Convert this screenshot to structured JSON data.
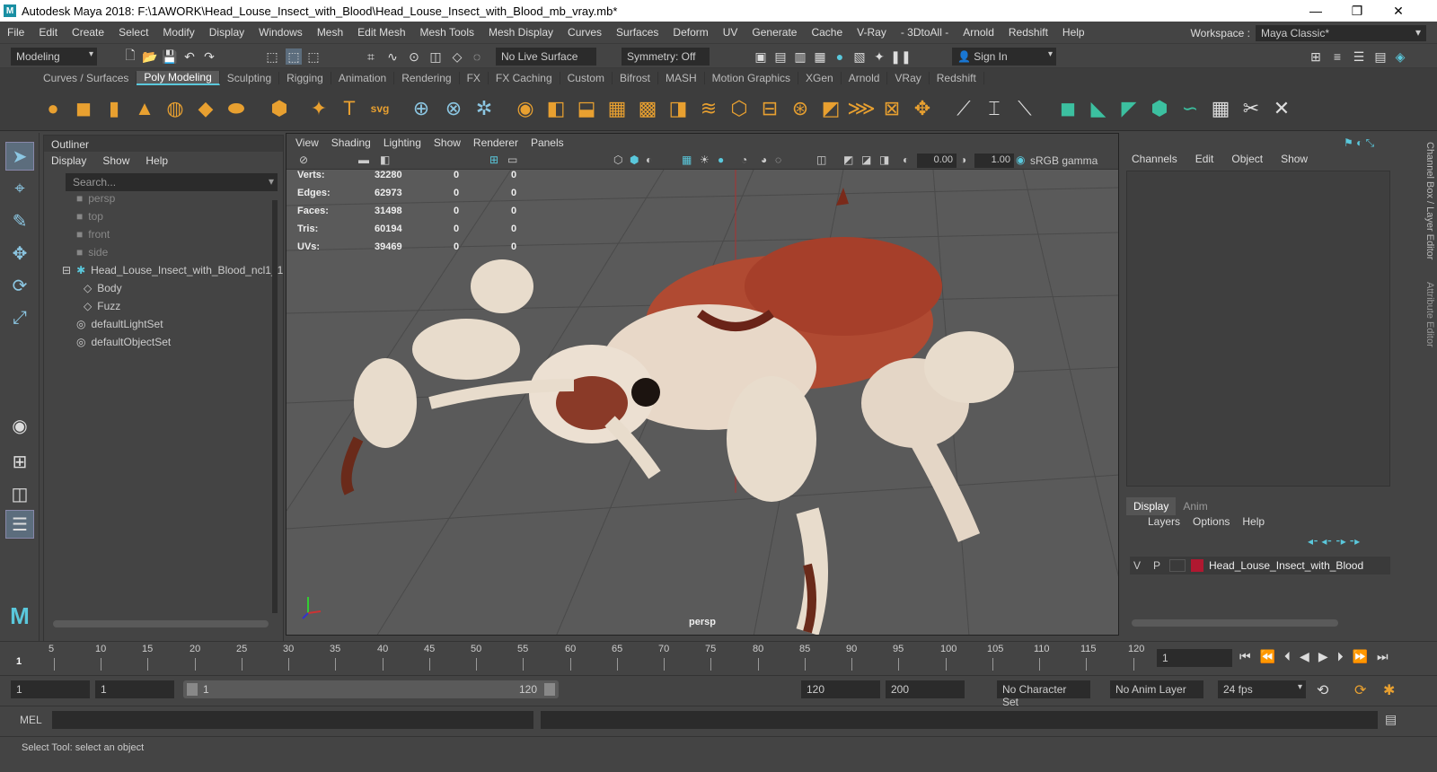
{
  "window": {
    "title": "Autodesk Maya 2018: F:\\1AWORK\\Head_Louse_Insect_with_Blood\\Head_Louse_Insect_with_Blood_mb_vray.mb*",
    "logo_letter": "M"
  },
  "menubar": {
    "items": [
      "File",
      "Edit",
      "Create",
      "Select",
      "Modify",
      "Display",
      "Windows",
      "Mesh",
      "Edit Mesh",
      "Mesh Tools",
      "Mesh Display",
      "Curves",
      "Surfaces",
      "Deform",
      "UV",
      "Generate",
      "Cache",
      "V-Ray",
      "- 3DtoAll -",
      "Arnold",
      "Redshift",
      "Help"
    ],
    "workspace_label": "Workspace :",
    "workspace_value": "Maya Classic*"
  },
  "statusline": {
    "mode": "Modeling",
    "live_surface": "No Live Surface",
    "symmetry": "Symmetry: Off",
    "sign_in": "Sign In"
  },
  "shelf": {
    "tabs": [
      "Curves / Surfaces",
      "Poly Modeling",
      "Sculpting",
      "Rigging",
      "Animation",
      "Rendering",
      "FX",
      "FX Caching",
      "Custom",
      "Bifrost",
      "MASH",
      "Motion Graphics",
      "XGen",
      "Arnold",
      "VRay",
      "Redshift"
    ],
    "active_tab": "Poly Modeling"
  },
  "outliner": {
    "title": "Outliner",
    "menu": [
      "Display",
      "Show",
      "Help"
    ],
    "search_placeholder": "Search...",
    "items": [
      {
        "label": "persp",
        "dim": true
      },
      {
        "label": "top",
        "dim": true
      },
      {
        "label": "front",
        "dim": true
      },
      {
        "label": "side",
        "dim": true
      },
      {
        "label": "Head_Louse_Insect_with_Blood_ncl1_1",
        "dim": false
      },
      {
        "label": "Body",
        "dim": false
      },
      {
        "label": "Fuzz",
        "dim": false
      },
      {
        "label": "defaultLightSet",
        "dim": false
      },
      {
        "label": "defaultObjectSet",
        "dim": false
      }
    ]
  },
  "viewport": {
    "menu": [
      "View",
      "Shading",
      "Lighting",
      "Show",
      "Renderer",
      "Panels"
    ],
    "exposure": "0.00",
    "gamma": "1.00",
    "colorspace": "sRGB gamma",
    "camera": "persp",
    "hud": [
      {
        "label": "Verts:",
        "v1": "32280",
        "v2": "0",
        "v3": "0"
      },
      {
        "label": "Edges:",
        "v1": "62973",
        "v2": "0",
        "v3": "0"
      },
      {
        "label": "Faces:",
        "v1": "31498",
        "v2": "0",
        "v3": "0"
      },
      {
        "label": "Tris:",
        "v1": "60194",
        "v2": "0",
        "v3": "0"
      },
      {
        "label": "UVs:",
        "v1": "39469",
        "v2": "0",
        "v3": "0"
      }
    ]
  },
  "channelbox": {
    "menu": [
      "Channels",
      "Edit",
      "Object",
      "Show"
    ],
    "side_tab_1": "Channel Box / Layer Editor",
    "side_tab_2": "Attribute Editor",
    "layer_tabs": [
      "Display",
      "Anim"
    ],
    "layer_menu": [
      "Layers",
      "Options",
      "Help"
    ],
    "layer": {
      "v": "V",
      "p": "P",
      "name": "Head_Louse_Insect_with_Blood",
      "color": "#b01830"
    }
  },
  "timeslider": {
    "ticks": [
      "5",
      "10",
      "15",
      "20",
      "25",
      "30",
      "35",
      "40",
      "45",
      "50",
      "55",
      "60",
      "65",
      "70",
      "75",
      "80",
      "85",
      "90",
      "95",
      "100",
      "105",
      "110",
      "115",
      "120"
    ],
    "current_marker": "1",
    "current_frame": "1"
  },
  "rangeslider": {
    "start": "1",
    "playback_start": "1",
    "range_start": "1",
    "range_end": "120",
    "playback_end": "120",
    "end": "200",
    "character_set": "No Character Set",
    "anim_layer": "No Anim Layer",
    "fps": "24 fps"
  },
  "cmdline": {
    "label": "MEL"
  },
  "helpline": {
    "text": "Select Tool: select an object"
  }
}
